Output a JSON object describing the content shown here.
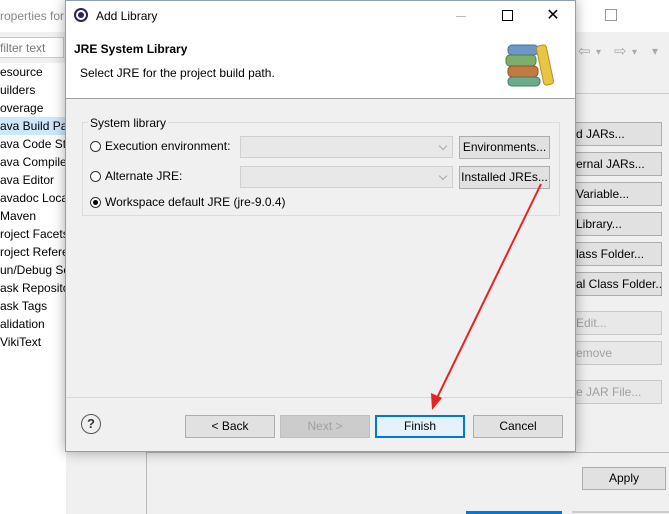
{
  "background": {
    "window_title_partial": "roperties for",
    "filter_placeholder": "filter text",
    "tree_items": [
      {
        "label": "esource",
        "selected": false
      },
      {
        "label": "uilders",
        "selected": false
      },
      {
        "label": "overage",
        "selected": false
      },
      {
        "label": "ava Build Pat",
        "selected": true
      },
      {
        "label": "ava Code Sty",
        "selected": false
      },
      {
        "label": "ava Compile",
        "selected": false
      },
      {
        "label": "ava Editor",
        "selected": false
      },
      {
        "label": "avadoc Locat",
        "selected": false
      },
      {
        "label": "Maven",
        "selected": false
      },
      {
        "label": "roject Facets",
        "selected": false
      },
      {
        "label": "roject Refere",
        "selected": false
      },
      {
        "label": "un/Debug Se",
        "selected": false
      },
      {
        "label": "ask Reposito",
        "selected": false
      },
      {
        "label": "ask Tags",
        "selected": false
      },
      {
        "label": "alidation",
        "selected": false
      },
      {
        "label": "VikiText",
        "selected": false
      }
    ],
    "side_buttons": [
      {
        "label": "d JARs...",
        "enabled": true
      },
      {
        "label": "ernal JARs...",
        "enabled": true
      },
      {
        "label": "Variable...",
        "enabled": true
      },
      {
        "label": "Library...",
        "enabled": true
      },
      {
        "label": "lass Folder...",
        "enabled": true
      },
      {
        "label": "al Class Folder...",
        "enabled": true
      },
      {
        "label": "Edit...",
        "enabled": false
      },
      {
        "label": "emove",
        "enabled": false
      },
      {
        "label": "e JAR File...",
        "enabled": false
      }
    ],
    "apply_label": "Apply"
  },
  "dialog": {
    "title": "Add Library",
    "header_title": "JRE System Library",
    "header_desc": "Select JRE for the project build path.",
    "group_label": "System library",
    "options": {
      "execution_env": "Execution environment:",
      "alternate_jre": "Alternate JRE:",
      "workspace_default": "Workspace default JRE (jre-9.0.4)"
    },
    "selected_option": "workspace_default",
    "environments_button": "Environments...",
    "installed_jres_button": "Installed JREs...",
    "help_glyph": "?",
    "back_button": "< Back",
    "next_button": "Next >",
    "finish_button": "Finish",
    "cancel_button": "Cancel",
    "close_glyph": "✕"
  },
  "colors": {
    "annotation_arrow": "#e8231f",
    "accent": "#0078d7"
  }
}
